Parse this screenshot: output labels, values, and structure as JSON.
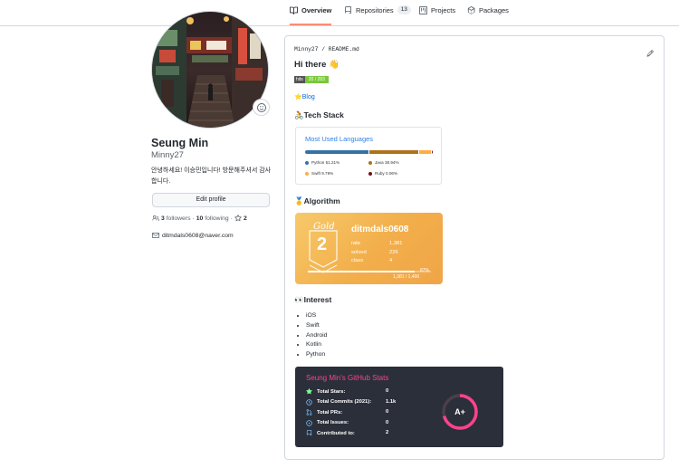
{
  "tabs": [
    {
      "label": "Overview",
      "icon": "book-icon",
      "selected": true
    },
    {
      "label": "Repositories",
      "icon": "repo-icon",
      "count": "13"
    },
    {
      "label": "Projects",
      "icon": "project-icon"
    },
    {
      "label": "Packages",
      "icon": "package-icon"
    }
  ],
  "profile": {
    "name": "Seung Min",
    "login": "Minny27",
    "bio": "안녕하세요! 이승민입니다! 방문해주셔서 감사합니다.",
    "edit_label": "Edit profile",
    "followers_count": "3",
    "followers_label": "followers",
    "following_count": "10",
    "following_label": "following",
    "stars_count": "2",
    "sep": "·",
    "email": "ditmdals0608@naver.com"
  },
  "readme": {
    "path": "Minny27 / README.md",
    "greeting": "Hi there 👋",
    "hits_label": "hits",
    "hits_value": "20 / 283",
    "blog_label": "Blog",
    "blog_icon": "⭐",
    "tech_heading": "Tech Stack",
    "tech_icon": "🚴",
    "algo_heading": "Algorithm",
    "algo_icon": "🥇",
    "interest_heading": "Interest",
    "interest_icon": "👀",
    "interests": [
      "iOS",
      "Swift",
      "Android",
      "Kotlin",
      "Python"
    ]
  },
  "languages": {
    "title": "Most Used Languages",
    "items": [
      {
        "label": "Python 51.21%",
        "pct": 51.21,
        "color": "#3572A5"
      },
      {
        "label": "Java 38.94%",
        "pct": 38.94,
        "color": "#b07219"
      },
      {
        "label": "Swift 9.79%",
        "pct": 9.79,
        "color": "#ffac45"
      },
      {
        "label": "Ruby 0.06%",
        "pct": 0.06,
        "color": "#701516"
      }
    ]
  },
  "solved": {
    "tier_word": "Gold",
    "tier_num": "2",
    "handle": "ditmdals0608",
    "rows": [
      {
        "label": "rate",
        "value": "1,381"
      },
      {
        "label": "solved",
        "value": "226"
      },
      {
        "label": "class",
        "value": "4"
      }
    ],
    "percent_label": "87%",
    "progress_text": "1,381 / 1,400",
    "progress": 0.87
  },
  "stats": {
    "title": "Seung Min's GitHub Stats",
    "rows": [
      {
        "label": "Total Stars:",
        "value": "0",
        "icon": "star-icon"
      },
      {
        "label": "Total Commits (2021):",
        "value": "1.1k",
        "icon": "clock-icon"
      },
      {
        "label": "Total PRs:",
        "value": "0",
        "icon": "pr-icon"
      },
      {
        "label": "Total Issues:",
        "value": "0",
        "icon": "issue-icon"
      },
      {
        "label": "Contributed to:",
        "value": "2",
        "icon": "repo-icon"
      }
    ],
    "grade": "A+",
    "ring_color": "#fe428e"
  }
}
